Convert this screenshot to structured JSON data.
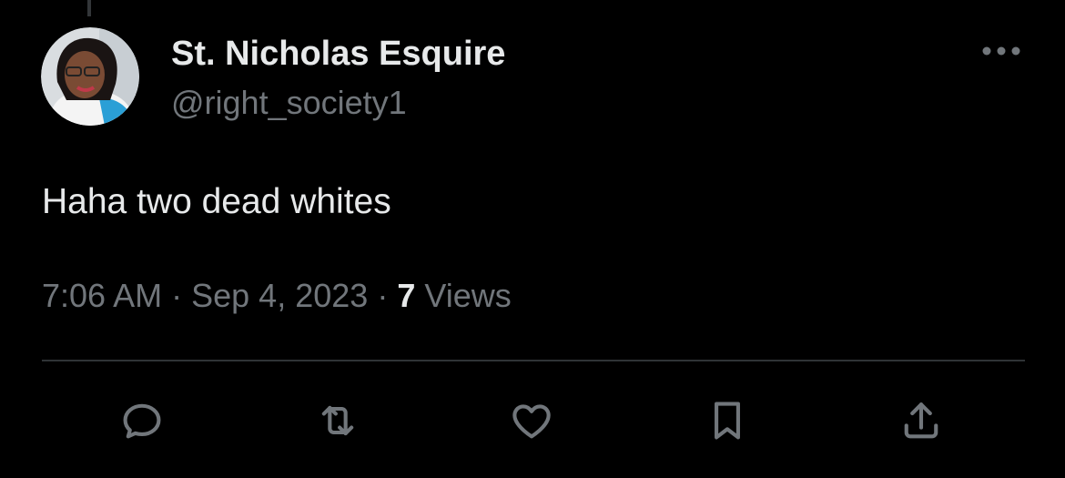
{
  "tweet": {
    "display_name": "St. Nicholas Esquire",
    "handle": "@right_society1",
    "text": "Haha two dead whites",
    "time": "7:06 AM",
    "separator": "·",
    "date": "Sep 4, 2023",
    "views_count": "7",
    "views_label": "Views"
  },
  "icons": {
    "more": "more-horizontal-icon",
    "reply": "reply-icon",
    "retweet": "retweet-icon",
    "like": "like-icon",
    "bookmark": "bookmark-icon",
    "share": "share-icon"
  },
  "colors": {
    "background": "#000000",
    "primary_text": "#e7e9ea",
    "secondary_text": "#71767b",
    "divider": "#2f3336"
  }
}
